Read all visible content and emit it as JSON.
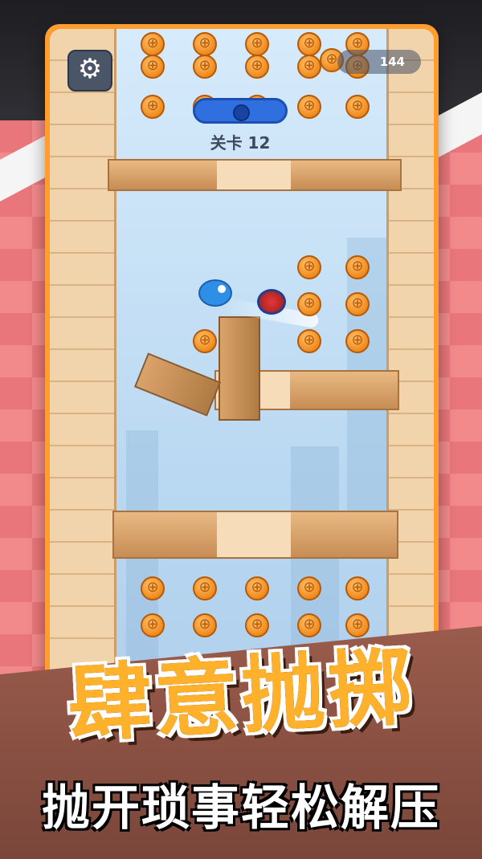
{
  "hud": {
    "score": "144",
    "level_label": "关卡 12",
    "settings_icon": "gear-icon"
  },
  "promo": {
    "title": "肆意抛掷",
    "subtitle": "抛开琐事轻松解压"
  },
  "colors": {
    "frame": "#ff9d2e",
    "title": "#ffb12b",
    "background": "#e8767a"
  }
}
